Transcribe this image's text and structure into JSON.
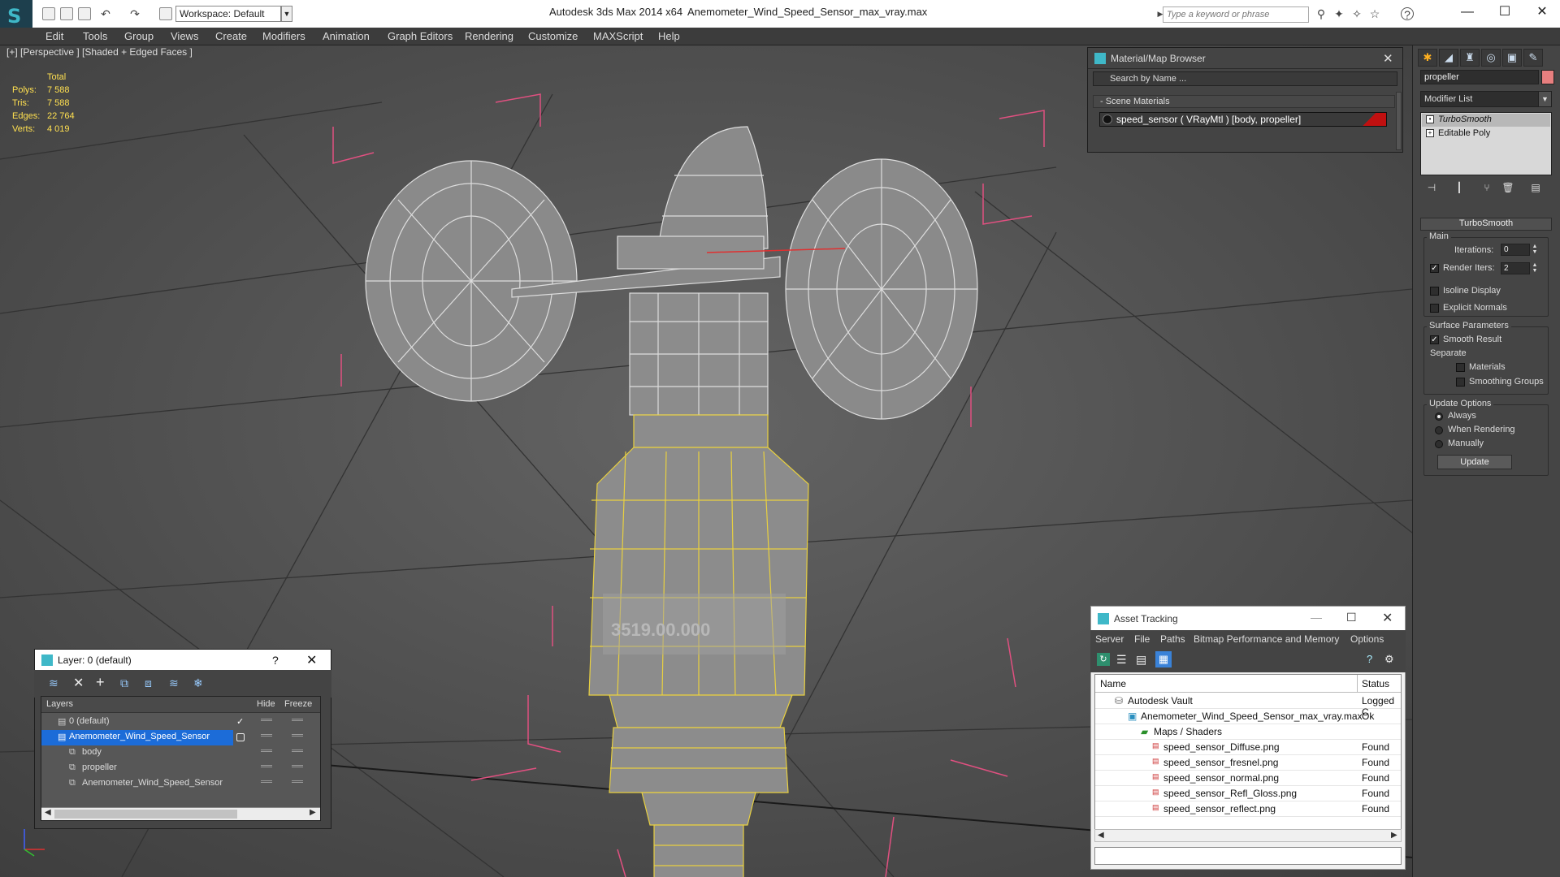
{
  "titlebar": {
    "workspace": "Workspace: Default",
    "app_title": "Autodesk 3ds Max  2014 x64",
    "file_title": "Anemometer_Wind_Speed_Sensor_max_vray.max",
    "search_placeholder": "Type a keyword or phrase"
  },
  "menu": [
    "Edit",
    "Tools",
    "Group",
    "Views",
    "Create",
    "Modifiers",
    "Animation",
    "Graph Editors",
    "Rendering",
    "Customize",
    "MAXScript",
    "Help"
  ],
  "viewport": {
    "label": "[+] [Perspective ] [Shaded + Edged Faces ]",
    "stats": {
      "header": "Total",
      "rows": [
        {
          "label": "Polys:",
          "value": "7 588"
        },
        {
          "label": "Tris:",
          "value": "7 588"
        },
        {
          "label": "Edges:",
          "value": "22 764"
        },
        {
          "label": "Verts:",
          "value": "4 019"
        }
      ]
    },
    "label_text": "3519.00.000"
  },
  "command_panel": {
    "object_name": "propeller",
    "object_color": "#e87f7f",
    "modifier_list": "Modifier List",
    "stack": [
      "TurboSmooth",
      "Editable Poly"
    ],
    "rollout_title": "TurboSmooth",
    "main_group": "Main",
    "iterations_label": "Iterations:",
    "iterations_value": "0",
    "render_iters_label": "Render Iters:",
    "render_iters_value": "2",
    "isoline_label": "Isoline Display",
    "explicit_normals_label": "Explicit Normals",
    "surface_group": "Surface Parameters",
    "smooth_result_label": "Smooth Result",
    "separate_label": "Separate",
    "materials_label": "Materials",
    "smoothing_groups_label": "Smoothing Groups",
    "update_group": "Update Options",
    "always_label": "Always",
    "when_rendering_label": "When Rendering",
    "manually_label": "Manually",
    "update_button": "Update"
  },
  "material_browser": {
    "title": "Material/Map Browser",
    "search_placeholder": "Search by Name ...",
    "section": "- Scene Materials",
    "material": "speed_sensor  ( VRayMtl ) [body, propeller]"
  },
  "layers_window": {
    "title": "Layer: 0 (default)",
    "help": "?",
    "col_layers": "Layers",
    "col_hide": "Hide",
    "col_freeze": "Freeze",
    "rows": [
      {
        "name": "0 (default)",
        "indent": 0
      },
      {
        "name": "Anemometer_Wind_Speed_Sensor",
        "indent": 0
      },
      {
        "name": "body",
        "indent": 1
      },
      {
        "name": "propeller",
        "indent": 1
      },
      {
        "name": "Anemometer_Wind_Speed_Sensor",
        "indent": 1
      }
    ]
  },
  "asset_tracking": {
    "title": "Asset Tracking",
    "menu": [
      "Server",
      "File",
      "Paths",
      "Bitmap Performance and Memory",
      "Options"
    ],
    "col_name": "Name",
    "col_status": "Status",
    "rows": [
      {
        "name": "Autodesk Vault",
        "status": "Logged C",
        "indent": 0
      },
      {
        "name": "Anemometer_Wind_Speed_Sensor_max_vray.max",
        "status": "Ok",
        "indent": 1
      },
      {
        "name": "Maps / Shaders",
        "status": "",
        "indent": 2
      },
      {
        "name": "speed_sensor_Diffuse.png",
        "status": "Found",
        "indent": 3
      },
      {
        "name": "speed_sensor_fresnel.png",
        "status": "Found",
        "indent": 3
      },
      {
        "name": "speed_sensor_normal.png",
        "status": "Found",
        "indent": 3
      },
      {
        "name": "speed_sensor_Refl_Gloss.png",
        "status": "Found",
        "indent": 3
      },
      {
        "name": "speed_sensor_reflect.png",
        "status": "Found",
        "indent": 3
      }
    ]
  }
}
